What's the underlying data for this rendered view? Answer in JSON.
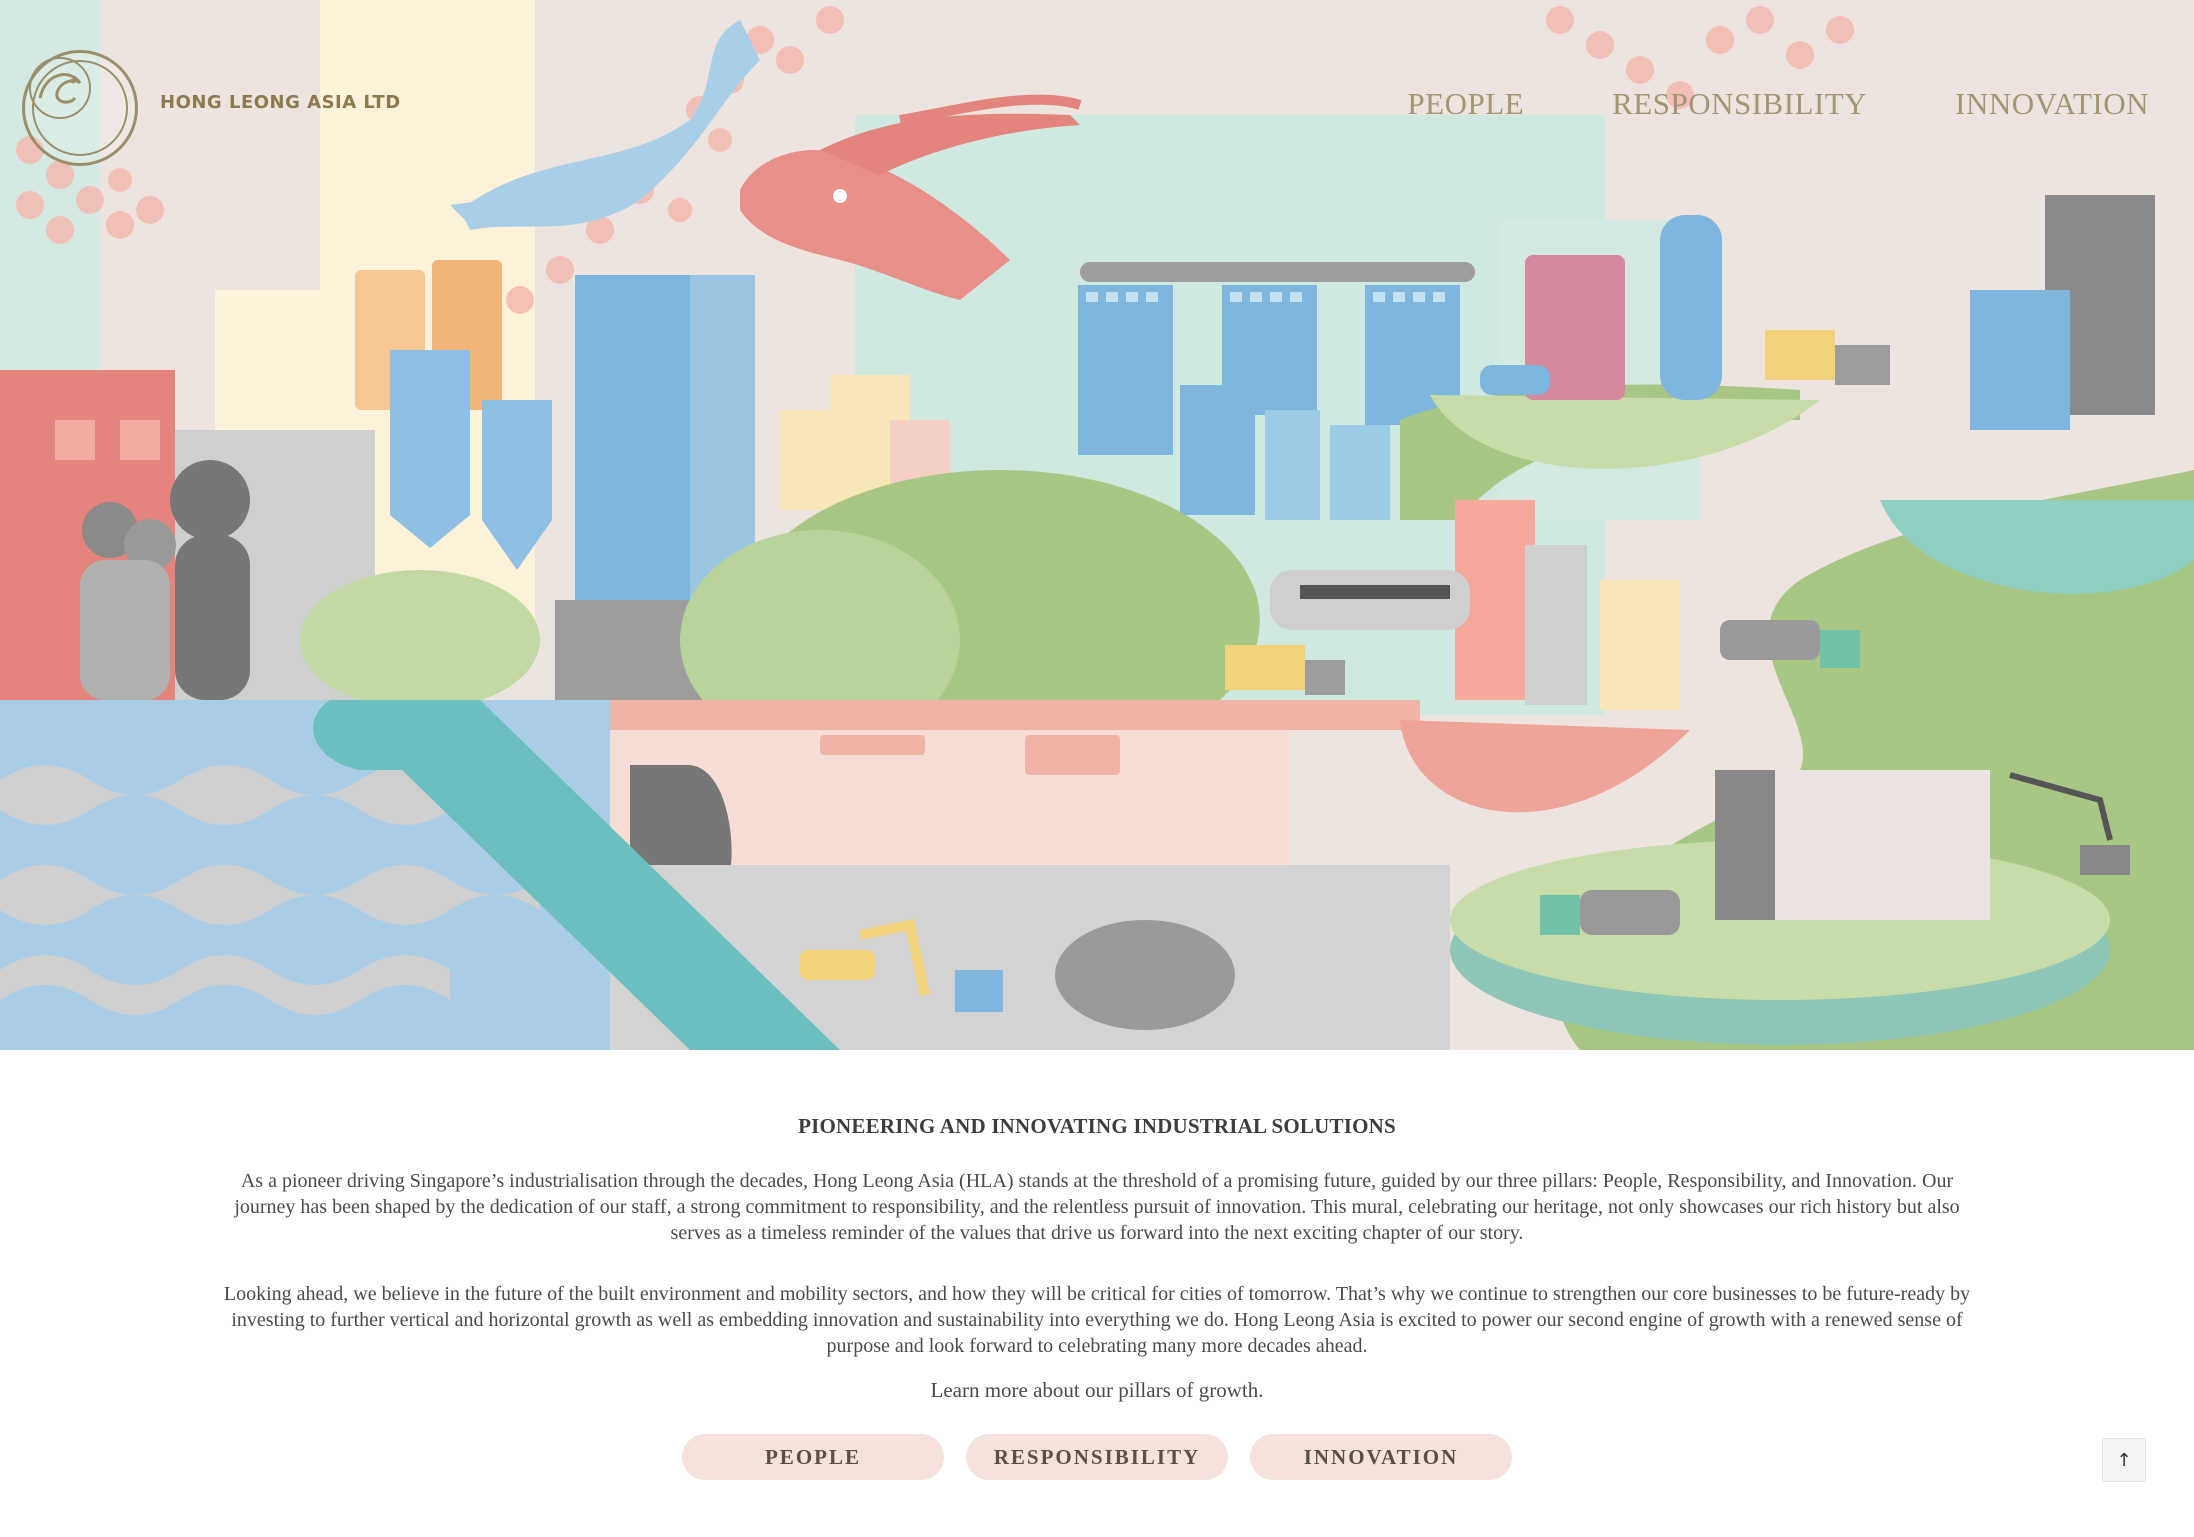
{
  "brand": {
    "name": "HONG LEONG ASIA LTD",
    "logo_icon": "dragon-emblem-icon"
  },
  "nav": {
    "items": [
      "PEOPLE",
      "RESPONSIBILITY",
      "INNOVATION"
    ]
  },
  "hero": {
    "illustration": "city-mural-illustration"
  },
  "intro": {
    "heading": "PIONEERING AND INNOVATING INDUSTRIAL SOLUTIONS",
    "paragraph1": "As a pioneer driving Singapore’s industrialisation through the decades, Hong Leong Asia (HLA) stands at the threshold of a promising future, guided by our three pillars: People, Responsibility, and Innovation. Our journey has been shaped by the dedication of our staff, a strong commitment to responsibility, and the relentless pursuit of innovation. This mural, celebrating our heritage, not only showcases our rich history but also serves as a timeless reminder of the values that drive us forward into the next exciting chapter of our story.",
    "paragraph2": "Looking ahead, we believe in the future of the built environment and mobility sectors, and how they will be critical for cities of tomorrow. That’s why we continue to strengthen our core businesses to be future-ready by investing to further vertical and horizontal growth as well as embedding innovation and sustainability into everything we do. Hong Leong Asia is excited to power our second engine of growth with a renewed sense of purpose and look forward to celebrating many more decades ahead.",
    "learn_more": "Learn more about our pillars of growth."
  },
  "pillars": [
    "PEOPLE",
    "RESPONSIBILITY",
    "INNOVATION"
  ],
  "back_to_top": {
    "label": "↑",
    "icon": "arrow-up-icon"
  },
  "colors": {
    "nav_gold": "#a39672",
    "pill_bg": "#f6e2dc",
    "coral": "#f0b4a7",
    "teal": "#6bbfbf",
    "sky": "#7fb6dd"
  }
}
